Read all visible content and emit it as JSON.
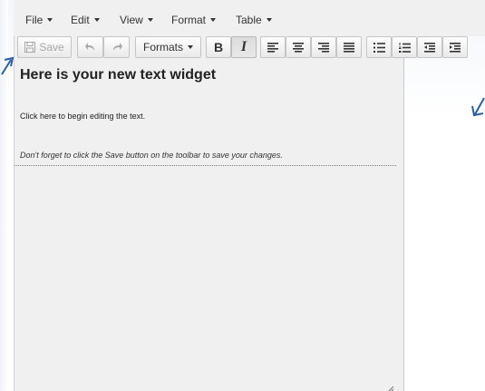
{
  "menubar": {
    "items": [
      {
        "label": "File"
      },
      {
        "label": "Edit"
      },
      {
        "label": "View"
      },
      {
        "label": "Format"
      },
      {
        "label": "Table"
      }
    ]
  },
  "toolbar": {
    "save_label": "Save",
    "formats_label": "Formats",
    "bold_label": "B",
    "italic_label": "I",
    "italic_active": true,
    "save_enabled": false,
    "undo_enabled": false,
    "redo_enabled": false,
    "icons": [
      "save-icon",
      "undo-icon",
      "redo-icon",
      "align-left-icon",
      "align-center-icon",
      "align-right-icon",
      "align-justify-icon",
      "bullet-list-icon",
      "numbered-list-icon",
      "outdent-icon",
      "indent-icon"
    ]
  },
  "content": {
    "heading": "Here is your new text widget",
    "paragraph1": "Click here to begin editing the text.",
    "paragraph2": "Don't forget to click the Save button on the toolbar to save your changes."
  },
  "colors": {
    "editor_bg": "#f0f0f0",
    "annotation_arrow": "#2a5ea8"
  }
}
